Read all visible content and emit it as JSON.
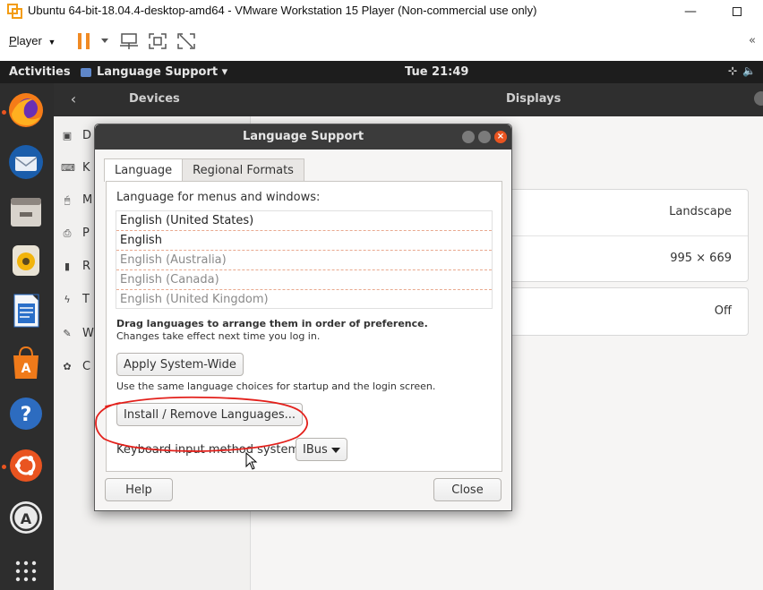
{
  "vmware": {
    "title": "Ubuntu 64-bit-18.04.4-desktop-amd64 - VMware Workstation 15 Player (Non-commercial use only)",
    "player_menu": "Player",
    "player_menu_accel": "P",
    "player_menu_rest": "layer",
    "toolbar_overflow": "«"
  },
  "topbar": {
    "activities": "Activities",
    "app_menu": "Language Support ▾",
    "clock": "Tue 21:49"
  },
  "settings": {
    "header_left": "Devices",
    "header_right": "Displays",
    "sidebar": [
      {
        "icon": "display-icon",
        "label": "D"
      },
      {
        "icon": "keyboard-icon",
        "label": "K"
      },
      {
        "icon": "mouse-icon",
        "label": "M"
      },
      {
        "icon": "printer-icon",
        "label": "P"
      },
      {
        "icon": "removable-media-icon",
        "label": "R"
      },
      {
        "icon": "thunderbolt-icon",
        "label": "T"
      },
      {
        "icon": "wacom-icon",
        "label": "W"
      },
      {
        "icon": "color-icon",
        "label": "C"
      }
    ],
    "orientation_value": "Landscape",
    "resolution_value": "995 × 669",
    "night_light_value": "Off"
  },
  "dialog": {
    "title": "Language Support",
    "tabs": [
      {
        "label": "Language",
        "active": true
      },
      {
        "label": "Regional Formats",
        "active": false
      }
    ],
    "list_heading": "Language for menus and windows:",
    "languages": [
      {
        "label": "English (United States)",
        "enabled": true
      },
      {
        "label": "English",
        "enabled": true
      },
      {
        "label": "English (Australia)",
        "enabled": false
      },
      {
        "label": "English (Canada)",
        "enabled": false
      },
      {
        "label": "English (United Kingdom)",
        "enabled": false
      }
    ],
    "drag_hint": "Drag languages to arrange them in order of preference.",
    "effect_hint": "Changes take effect next time you log in.",
    "apply_button": "Apply System-Wide",
    "apply_hint": "Use the same language choices for startup and the login screen.",
    "install_button": "Install / Remove Languages...",
    "input_method_label": "Keyboard input method system:",
    "input_method_value": "IBus",
    "help_button": "Help",
    "close_button": "Close"
  },
  "colors": {
    "ubuntu_orange": "#e95420",
    "annotation_red": "#e3201b",
    "dialog_titlebar": "#3b3b3b"
  }
}
